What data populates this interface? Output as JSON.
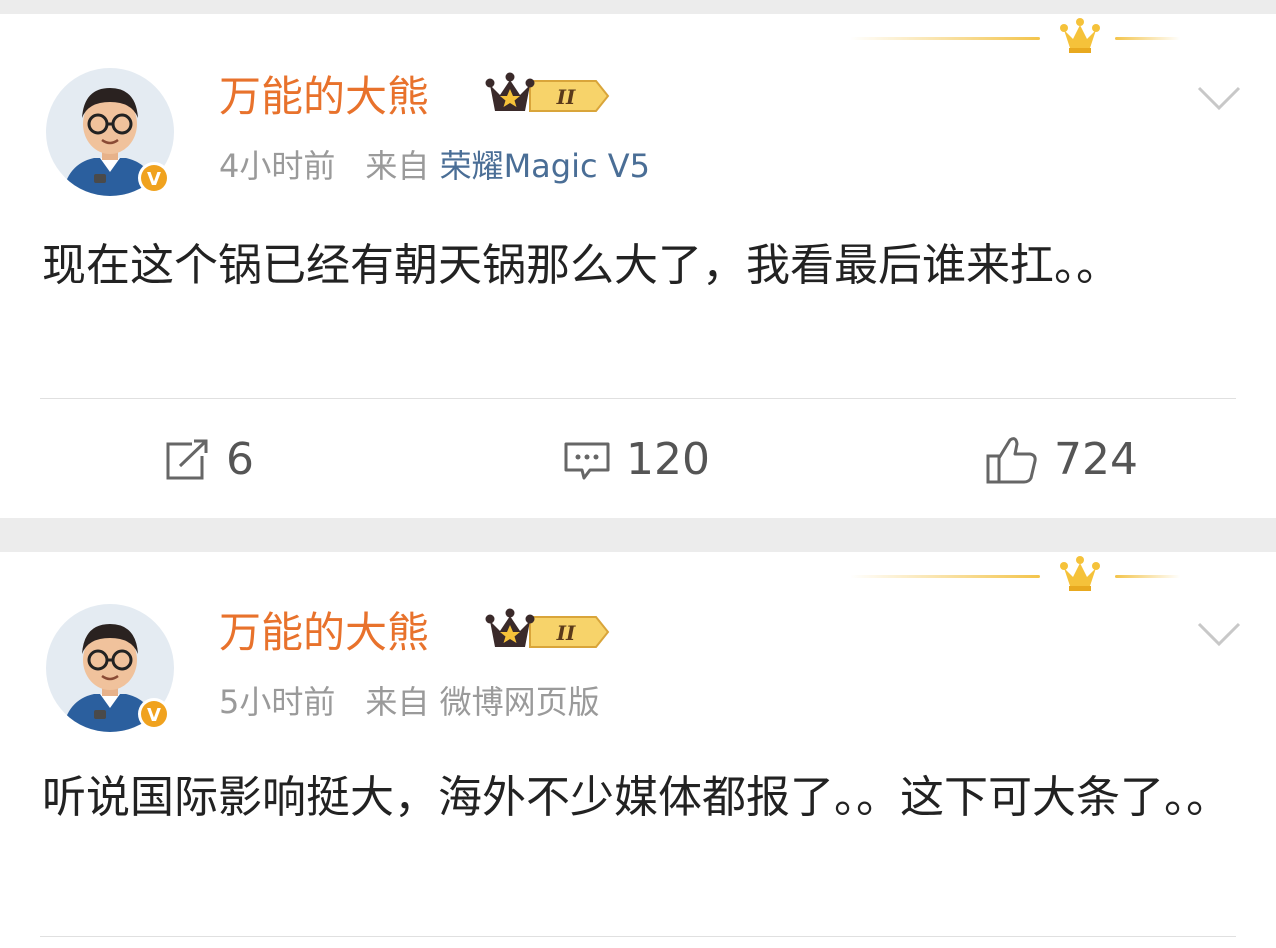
{
  "posts": [
    {
      "username": "万能的大熊",
      "badge_level": "II",
      "time": "4小时前",
      "source_prefix": "来自",
      "source": "荣耀Magic V5",
      "content": "现在这个锅已经有朝天锅那么大了，我看最后谁来扛。。",
      "actions": {
        "reposts": "6",
        "comments": "120",
        "likes": "724"
      },
      "verified": "V"
    },
    {
      "username": "万能的大熊",
      "badge_level": "II",
      "time": "5小时前",
      "source_prefix": "来自",
      "source": "微博网页版",
      "content": "听说国际影响挺大，海外不少媒体都报了。。这下可大条了。。",
      "verified": "V"
    }
  ],
  "icons": {
    "repost": "repost-icon",
    "comment": "comment-icon",
    "like": "thumbs-up-icon",
    "menu": "chevron-down-icon",
    "crown": "crown-icon"
  },
  "colors": {
    "username": "#e8722c",
    "source_link": "#4a6e96",
    "meta": "#9a9a9a",
    "text": "#222222",
    "verified_badge": "#f0a21e"
  }
}
